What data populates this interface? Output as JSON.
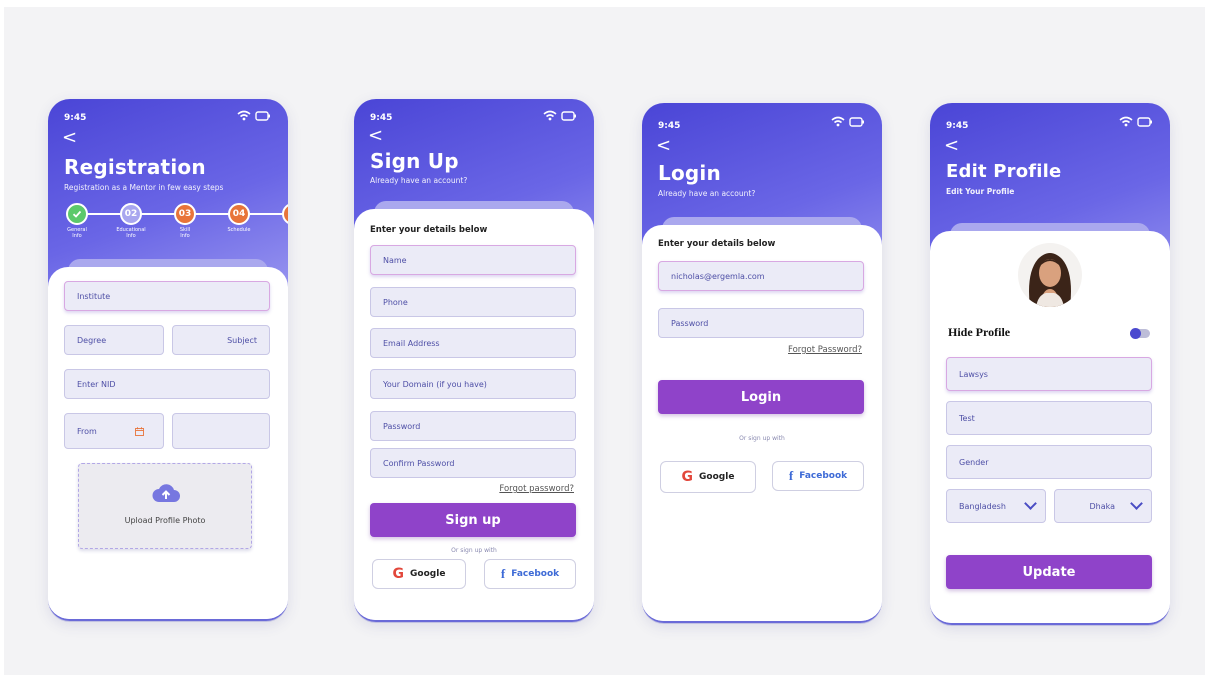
{
  "status_time": "9:45",
  "back_glyph": "<",
  "registration": {
    "title": "Registration",
    "subtitle": "Registration as a Mentor in few easy steps",
    "steps": [
      {
        "num": "",
        "label_line1": "General",
        "label_line2": "Info",
        "status": "done",
        "color": "#5cc96b"
      },
      {
        "num": "02",
        "label_line1": "Educational",
        "label_line2": "Info",
        "status": "current",
        "color": "#a8a6ef"
      },
      {
        "num": "03",
        "label_line1": "Skill",
        "label_line2": "Info",
        "status": "upcoming",
        "color": "#e8743a"
      },
      {
        "num": "04",
        "label_line1": "Schedule",
        "label_line2": "",
        "status": "upcoming",
        "color": "#e8743a"
      },
      {
        "num": "0",
        "label_line1": "",
        "label_line2": "",
        "status": "upcoming",
        "color": "#e8743a"
      }
    ],
    "fields": {
      "institute": "Institute",
      "degree": "Degree",
      "subject": "Subject",
      "nid": "Enter NID",
      "from": "From",
      "to": ""
    },
    "upload_label": "Upload Profile Photo"
  },
  "signup": {
    "title": "Sign Up",
    "subtitle": "Already have an account?",
    "section": "Enter your details below",
    "fields": [
      "Name",
      "Phone",
      "Email Address",
      "Your Domain (if you have)",
      "Password",
      "Confirm Password"
    ],
    "forgot": "Forgot password?",
    "button": "Sign up",
    "or_text": "Or sign up with",
    "google": "Google",
    "facebook": "Facebook"
  },
  "login": {
    "title": "Login",
    "subtitle": "Already have an account?",
    "section": "Enter your details below",
    "email_value": "nicholas@ergemla.com",
    "password_placeholder": "Password",
    "forgot": "Forgot Password?",
    "button": "Login",
    "or_text": "Or sign up with",
    "google": "Google",
    "facebook": "Facebook"
  },
  "edit_profile": {
    "title": "Edit Profile",
    "subtitle": "Edit Your Profile",
    "hide_profile": "Hide Profile",
    "hide_profile_on": true,
    "fields": [
      "Lawsys",
      "Test",
      "Gender"
    ],
    "country": "Bangladesh",
    "city": "Dhaka",
    "button": "Update"
  },
  "colors": {
    "header_start": "#4a45d6",
    "header_end": "#9a97f0",
    "primary_button": "#8f43c9",
    "field_bg": "#ebebf7",
    "field_text": "#4e4fa6"
  }
}
